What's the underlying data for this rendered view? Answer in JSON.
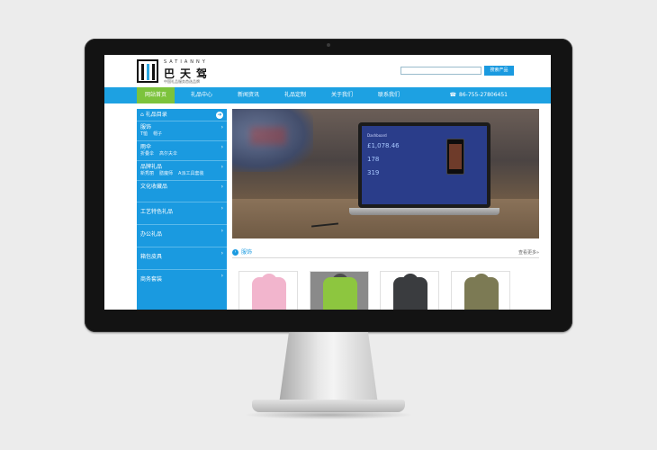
{
  "header": {
    "brand_en": "SATIANNY",
    "brand_cn": "巴天驾",
    "brand_tagline": "中国礼品服务首选品牌",
    "search_button": "搜索产品",
    "search_value": ""
  },
  "nav": {
    "items": [
      "网站首页",
      "礼品中心",
      "新闻资讯",
      "礼品定制",
      "关于我们",
      "联系我们"
    ],
    "phone": "86-755-27806451"
  },
  "sidebar": {
    "title": "礼品目录",
    "categories": [
      {
        "title": "服饰",
        "subs": [
          "T恤",
          "帽子"
        ]
      },
      {
        "title": "雨伞",
        "subs": [
          "折叠伞",
          "高尔夫伞"
        ]
      },
      {
        "title": "品牌礼品",
        "subs": [
          "新秀丽",
          "膳魔师",
          "A派工具套装"
        ]
      },
      {
        "title": "文化收藏品",
        "subs": []
      },
      {
        "title": "工艺特色礼品",
        "subs": []
      },
      {
        "title": "办公礼品",
        "subs": []
      },
      {
        "title": "箱包皮具",
        "subs": []
      },
      {
        "title": "商务套装",
        "subs": []
      }
    ]
  },
  "banner": {
    "dashboard_title": "Dashboard",
    "value1": "£1,078.46",
    "value2": "178",
    "value3": "319"
  },
  "products": {
    "section_title": "服饰",
    "more": "查看更多»"
  },
  "colors": {
    "nav_blue": "#1da1e2",
    "active_green": "#7cc33c",
    "sidebar_blue": "#1a9ae0"
  }
}
